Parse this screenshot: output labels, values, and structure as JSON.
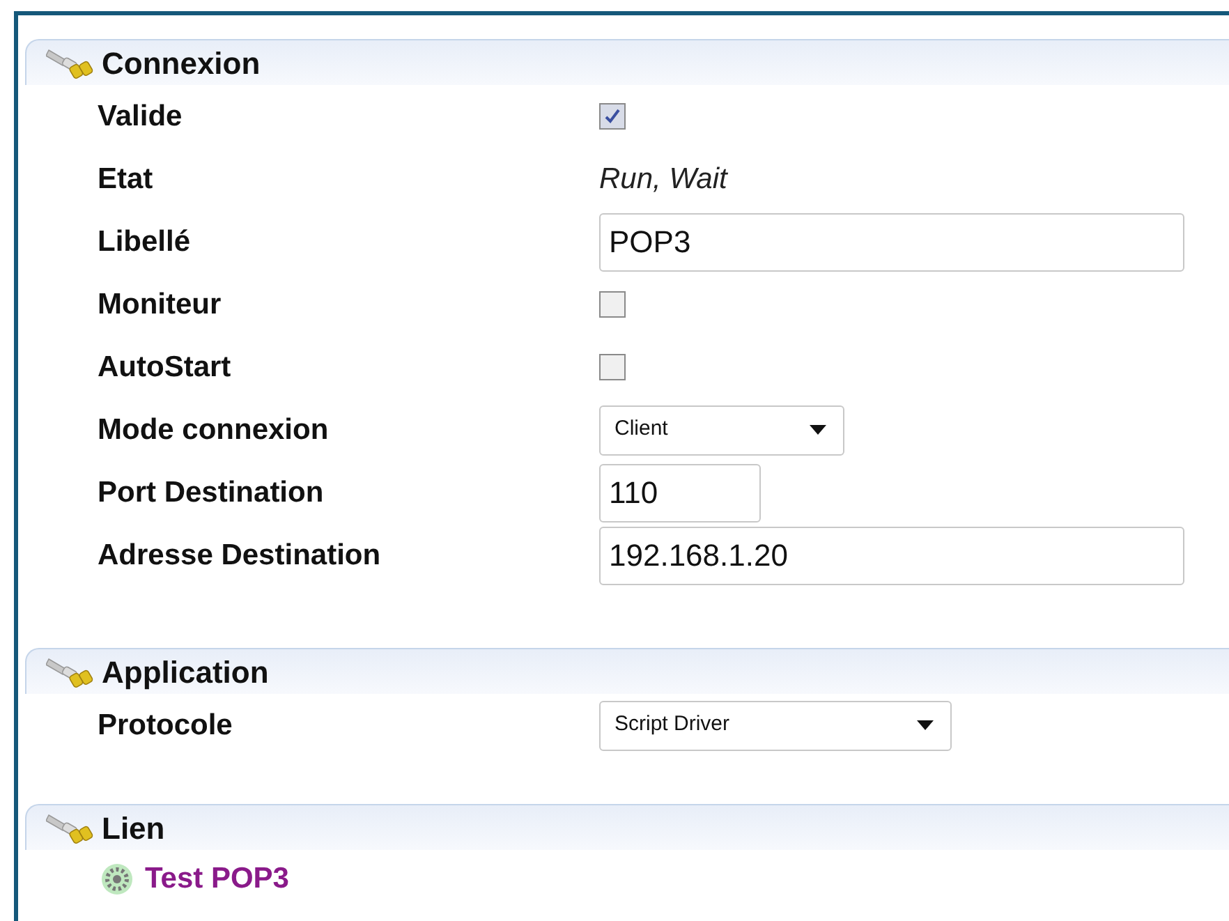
{
  "sections": [
    {
      "title": "Connexion",
      "rows": [
        {
          "label": "Valide",
          "kind": "checkbox",
          "checked": true
        },
        {
          "label": "Etat",
          "kind": "text",
          "value": "Run, Wait"
        },
        {
          "label": "Libellé",
          "kind": "wide-input",
          "value": "POP3"
        },
        {
          "label": "Moniteur",
          "kind": "checkbox",
          "checked": false
        },
        {
          "label": "AutoStart",
          "kind": "checkbox",
          "checked": false
        },
        {
          "label": "Mode connexion",
          "kind": "select",
          "value": "Client"
        },
        {
          "label": "Port Destination",
          "kind": "short-input",
          "value": "110"
        },
        {
          "label": "Adresse Destination",
          "kind": "wide-input",
          "value": "192.168.1.20"
        }
      ]
    },
    {
      "title": "Application",
      "rows": [
        {
          "label": "Protocole",
          "kind": "select",
          "value": "Script Driver"
        }
      ]
    },
    {
      "title": "Lien",
      "links": [
        "Test POP3"
      ]
    }
  ]
}
